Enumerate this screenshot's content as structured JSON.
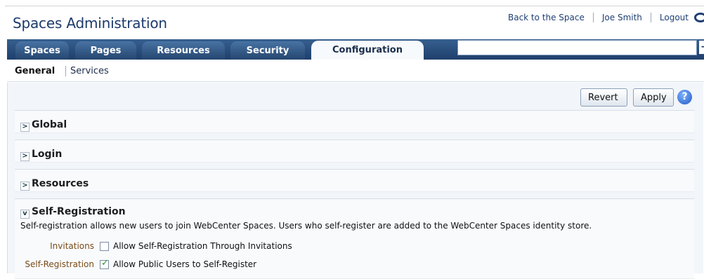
{
  "app": {
    "title": "Spaces Administration"
  },
  "header": {
    "back_link": "Back to the Space",
    "user": "Joe Smith",
    "logout": "Logout"
  },
  "tabs": [
    {
      "label": "Spaces",
      "active": false
    },
    {
      "label": "Pages",
      "active": false
    },
    {
      "label": "Resources",
      "active": false
    },
    {
      "label": "Security",
      "active": false
    },
    {
      "label": "Configuration",
      "active": true
    }
  ],
  "subnav": {
    "active": "General",
    "other": "Services"
  },
  "actions": {
    "revert": "Revert",
    "apply": "Apply"
  },
  "sections": [
    {
      "label": "Global",
      "expanded": false
    },
    {
      "label": "Login",
      "expanded": false
    },
    {
      "label": "Resources",
      "expanded": false
    },
    {
      "label": "Self-Registration",
      "expanded": true
    }
  ],
  "self_registration": {
    "description": "Self-registration allows new users to join WebCenter Spaces. Users who self-register are added to the WebCenter Spaces identity store.",
    "fields": [
      {
        "label": "Invitations",
        "checkbox_text": "Allow Self-Registration Through Invitations",
        "checked": false
      },
      {
        "label": "Self-Registration",
        "checkbox_text": "Allow Public Users to Self-Register",
        "checked": true
      }
    ]
  },
  "icons": {
    "help": "help-icon",
    "search_go": "arrow-right-icon",
    "chevron_collapsed": ">",
    "chevron_expanded": "v",
    "logo": "oracle-logo-icon"
  },
  "colors": {
    "primary": "#1f3f74",
    "tabbar": "#2b4f7d",
    "field_label": "#7a4b17",
    "panel": "#f2f5f9"
  }
}
